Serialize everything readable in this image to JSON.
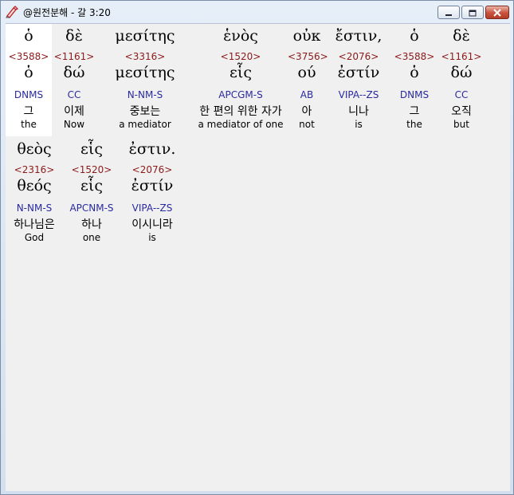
{
  "window": {
    "title": "@원전분해 - 갈 3:20",
    "buttons": {
      "minimize": "minimize-icon",
      "maximize": "maximize-icon",
      "close": "close-icon"
    },
    "close_color": "#c8523c"
  },
  "colors": {
    "strongs": "#8b1a1a",
    "parsing": "#2a2aa0",
    "selected_bg": "#ffffff",
    "client_bg": "#f0f0f0"
  },
  "rows": [
    {
      "words": [
        {
          "greek": "ὁ",
          "strongs": "<3588>",
          "lemma": "ὁ",
          "parsing": "DNMS",
          "korean": "그",
          "english": "the",
          "selected": true
        },
        {
          "greek": "δὲ",
          "strongs": "<1161>",
          "lemma": "δώ",
          "parsing": "CC",
          "korean": "이제",
          "english": "Now"
        },
        {
          "greek": "μεσίτης",
          "strongs": "<3316>",
          "lemma": "μεσίτης",
          "parsing": "N-NM-S",
          "korean": "중보는",
          "english": "a mediator"
        },
        {
          "greek": "ἑνὸς",
          "strongs": "<1520>",
          "lemma": "εἷς",
          "parsing": "APCGM-S",
          "korean": "한 편의 위한 자가",
          "english": "a mediator of one"
        },
        {
          "greek": "οὐκ",
          "strongs": "<3756>",
          "lemma": "ού",
          "parsing": "AB",
          "korean": "아",
          "english": "not"
        },
        {
          "greek": "ἔστιν,",
          "strongs": "<2076>",
          "lemma": "ἐστίν",
          "parsing": "VIPA--ZS",
          "korean": "니나",
          "english": "is"
        },
        {
          "greek": "ὁ",
          "strongs": "<3588>",
          "lemma": "ὁ",
          "parsing": "DNMS",
          "korean": "그",
          "english": "the"
        },
        {
          "greek": "δὲ",
          "strongs": "<1161>",
          "lemma": "δώ",
          "parsing": "CC",
          "korean": "오직",
          "english": "but"
        }
      ]
    },
    {
      "words": [
        {
          "greek": "θεὸς",
          "strongs": "<2316>",
          "lemma": "θεός",
          "parsing": "N-NM-S",
          "korean": "하나님은",
          "english": "God"
        },
        {
          "greek": "εἷς",
          "strongs": "<1520>",
          "lemma": "εἷς",
          "parsing": "APCNM-S",
          "korean": "하나",
          "english": "one"
        },
        {
          "greek": "ἐστιν.",
          "strongs": "<2076>",
          "lemma": "ἐστίν",
          "parsing": "VIPA--ZS",
          "korean": "이시니라",
          "english": "is"
        }
      ]
    }
  ]
}
